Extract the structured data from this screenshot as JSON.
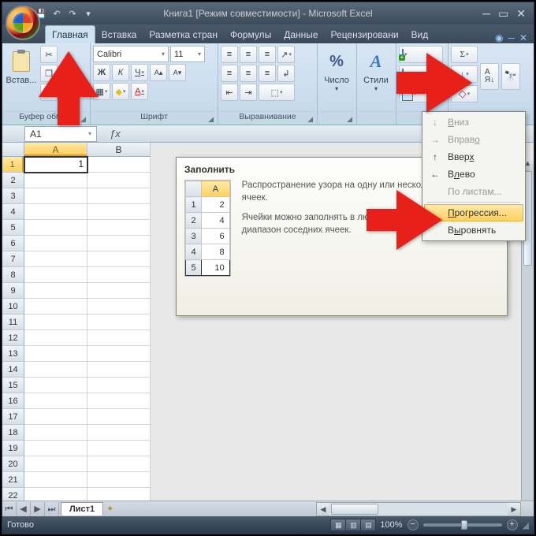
{
  "app": {
    "title": "Книга1  [Режим совместимости] - Microsoft Excel"
  },
  "qat": {
    "save": "💾",
    "undo": "↶",
    "redo": "↷"
  },
  "tabs": {
    "home": "Главная",
    "insert": "Вставка",
    "layout": "Разметка стран",
    "formulas": "Формулы",
    "data": "Данные",
    "review": "Рецензировани",
    "view": "Вид"
  },
  "ribbon": {
    "clipboard": {
      "paste": "Встав...",
      "label": "Буфер обме..."
    },
    "font": {
      "label": "Шрифт",
      "name": "Calibri",
      "size": "11",
      "bold": "Ж",
      "italic": "К",
      "underline": "Ч",
      "grow": "A▴",
      "shrink": "A▾",
      "border": "▦",
      "fill": "◆",
      "color": "A"
    },
    "align": {
      "label": "Выравнивание",
      "top": "≡",
      "mid": "≡",
      "bot": "≡",
      "left": "≡",
      "center": "≡",
      "right": "≡",
      "dec": "⇤",
      "inc": "⇥",
      "orient": "↗",
      "wrap": "↲",
      "merge": "⬚"
    },
    "number": {
      "big": "%",
      "label": "Число"
    },
    "styles": {
      "big": "A",
      "label": "Стили"
    },
    "cells": {
      "insert": "+",
      "delete": "−",
      "format": "",
      "label": ""
    },
    "editing": {
      "sum": "Σ",
      "fill": "↓",
      "clear": "◇",
      "sort": "A↓",
      "find": "🔍",
      "label": ""
    }
  },
  "namebox": "A1",
  "grid": {
    "cols": [
      "A",
      "B"
    ],
    "rows": [
      "1",
      "2",
      "3",
      "4",
      "5",
      "6",
      "7",
      "8",
      "9",
      "10",
      "11",
      "12",
      "13",
      "14",
      "15",
      "16",
      "17",
      "18",
      "19",
      "20",
      "21",
      "22"
    ],
    "A1": "1"
  },
  "tooltip": {
    "title": "Заполнить",
    "p1": "Распространение узора на одну или несколько соседних ячеек.",
    "p2": "Ячейки можно заполнять в любом направлении и в любой диапазон соседних ячеек.",
    "mini_col": "A",
    "mini": [
      {
        "r": "1",
        "v": "2"
      },
      {
        "r": "2",
        "v": "4"
      },
      {
        "r": "3",
        "v": "6"
      },
      {
        "r": "4",
        "v": "8"
      },
      {
        "r": "5",
        "v": "10"
      }
    ]
  },
  "fillmenu": {
    "down": "Вниз",
    "right": "Вправо",
    "up": "Вверх",
    "left": "Влево",
    "sheets": "По листам...",
    "progression": "Прогрессия...",
    "justify": "Выровнять"
  },
  "sheets": {
    "sheet1": "Лист1"
  },
  "status": {
    "ready": "Готово",
    "zoom": "100%"
  }
}
